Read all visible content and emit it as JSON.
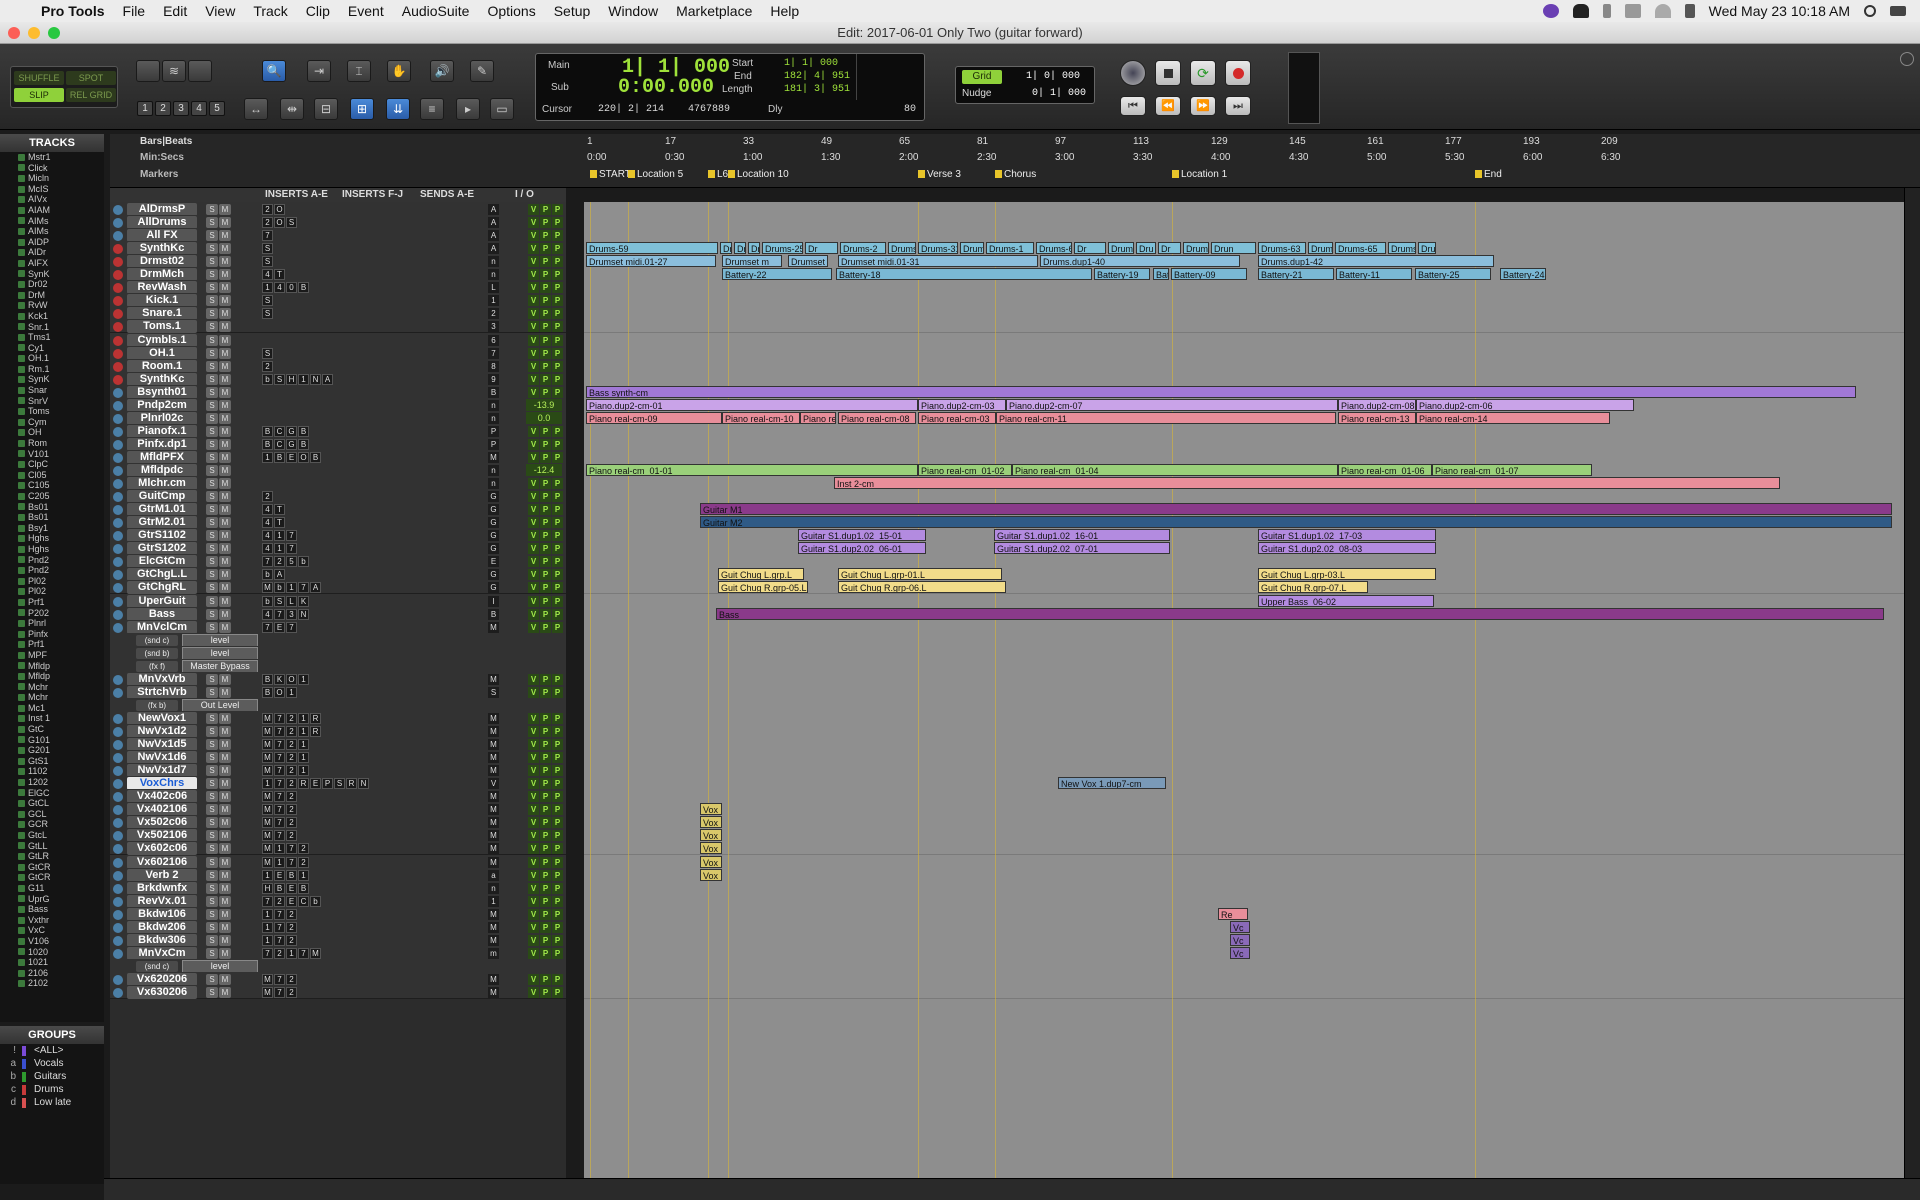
{
  "menubar": {
    "app": "Pro Tools",
    "items": [
      "File",
      "Edit",
      "View",
      "Track",
      "Clip",
      "Event",
      "AudioSuite",
      "Options",
      "Setup",
      "Window",
      "Marketplace",
      "Help"
    ],
    "clock": "Wed May 23  10:18 AM"
  },
  "window": {
    "title": "Edit: 2017-06-01 Only Two (guitar forward)"
  },
  "toolbar": {
    "modes": [
      "SHUFFLE",
      "SPOT",
      "SLIP",
      "REL GRID"
    ],
    "zoom_presets": [
      "1",
      "2",
      "3",
      "4",
      "5"
    ]
  },
  "counter": {
    "main_label": "Main",
    "main": "1| 1| 000",
    "sub_label": "Sub",
    "sub": "0:00.000",
    "start_label": "Start",
    "start": "1| 1| 000",
    "end_label": "End",
    "end": "182| 4| 951",
    "length_label": "Length",
    "length": "181| 3| 951",
    "cursor_label": "Cursor",
    "cursor": "220| 2| 214",
    "samples": "4767889",
    "dly_label": "Dly",
    "num": "80"
  },
  "grid": {
    "grid_label": "Grid",
    "grid": "1| 0| 000",
    "nudge_label": "Nudge",
    "nudge": "0| 1| 000"
  },
  "ruler": {
    "bars_label": "Bars|Beats",
    "minsecs_label": "Min:Secs",
    "markers_label": "Markers",
    "bars": [
      "1",
      "17",
      "33",
      "49",
      "65",
      "81",
      "97",
      "113",
      "129",
      "145",
      "161",
      "177",
      "193",
      "209"
    ],
    "times": [
      "0:00",
      "0:30",
      "1:00",
      "1:30",
      "2:00",
      "2:30",
      "3:00",
      "3:30",
      "4:00",
      "4:30",
      "5:00",
      "5:30",
      "6:00",
      "6:30"
    ],
    "markers": [
      "START",
      "Location 5",
      "L6",
      "Location 10",
      "Verse 3",
      "Chorus",
      "Location 1",
      "End"
    ]
  },
  "columns": {
    "inserts_ae": "INSERTS A-E",
    "inserts_fj": "INSERTS F-J",
    "sends_ae": "SENDS A-E",
    "io": "I / O"
  },
  "sidebar": {
    "tracks_title": "TRACKS",
    "groups_title": "GROUPS",
    "track_list": [
      "Mstr1",
      "Click",
      "Micln",
      "McIS",
      "AIVx",
      "AIAM",
      "AIMs",
      "AIMs",
      "AIDP",
      "AIDr",
      "AIFX",
      "SynK",
      "Dr02",
      "DrM",
      "RvW",
      "Kck1",
      "Snr.1",
      "Tms1",
      "Cy1",
      "OH.1",
      "Rm.1",
      "SynK",
      "Snar",
      "SnrV",
      "Toms",
      "Cym",
      "OH",
      "Rom",
      "V101",
      "ClpC",
      "Cl05",
      "C105",
      "C205",
      "Bs01",
      "Bs01",
      "Bsy1",
      "Hghs",
      "Hghs",
      "Pnd2",
      "Pnd2",
      "Pl02",
      "Pl02",
      "Prf1",
      "P202",
      "Plnrl",
      "Pinfx",
      "Prf1",
      "MPF",
      "Mfldp",
      "Mfldp",
      "Mchr",
      "Mchr",
      "Mc1",
      "Inst 1",
      "GtC",
      "G101",
      "G201",
      "GtS1",
      "1102",
      "1202",
      "ElGC",
      "GtCL",
      "GCL",
      "GCR",
      "GtcL",
      "GtLL",
      "GtLR",
      "GtCR",
      "GtCR",
      "G11",
      "UprG",
      "Bass",
      "Vxthr",
      "VxC",
      "V106",
      "1020",
      "1021",
      "2106",
      "2102"
    ],
    "groups": [
      {
        "id": "!",
        "name": "<ALL>",
        "color": "#7b4bd6"
      },
      {
        "id": "a",
        "name": "Vocals",
        "color": "#3a4fd0"
      },
      {
        "id": "b",
        "name": "Guitars",
        "color": "#2e9a2e"
      },
      {
        "id": "c",
        "name": "Drums",
        "color": "#c73a3a"
      },
      {
        "id": "d",
        "name": "Low late",
        "color": "#d85050"
      }
    ]
  },
  "tracks": [
    {
      "name": "AlDrmsP",
      "ins": [
        "2",
        "O"
      ],
      "io": "A",
      "vol": ""
    },
    {
      "name": "AllDrums",
      "ins": [
        "2",
        "O",
        "S"
      ],
      "io": "A",
      "vol": ""
    },
    {
      "name": "All FX",
      "ins": [
        "7"
      ],
      "io": "A",
      "vol": ""
    },
    {
      "name": "SynthKc",
      "ins": [
        "S"
      ],
      "io": "A",
      "vol": "",
      "rec": "red"
    },
    {
      "name": "Drmst02",
      "ins": [
        "S"
      ],
      "io": "n",
      "vol": "",
      "rec": "red"
    },
    {
      "name": "DrmMch",
      "ins": [
        "4",
        "T"
      ],
      "io": "n",
      "vol": "",
      "rec": "red"
    },
    {
      "name": "RevWash",
      "ins": [
        "1",
        "4",
        "0",
        "B"
      ],
      "io": "L",
      "vol": "",
      "rec": "red"
    },
    {
      "name": "Kick.1",
      "ins": [
        "S"
      ],
      "io": "1",
      "vol": "",
      "rec": "red"
    },
    {
      "name": "Snare.1",
      "ins": [
        "S"
      ],
      "io": "2",
      "vol": "",
      "rec": "red"
    },
    {
      "name": "Toms.1",
      "ins": [],
      "io": "3",
      "vol": "",
      "rec": "red"
    },
    {
      "name": "Cymbls.1",
      "ins": [],
      "io": "6",
      "vol": "",
      "rec": "red"
    },
    {
      "name": "OH.1",
      "ins": [
        "S"
      ],
      "io": "7",
      "vol": "",
      "rec": "red"
    },
    {
      "name": "Room.1",
      "ins": [
        "2"
      ],
      "io": "8",
      "vol": "",
      "rec": "red"
    },
    {
      "name": "SynthKc",
      "ins": [
        "b",
        "S",
        "H",
        "1",
        "N",
        "A"
      ],
      "io": "9",
      "vol": "",
      "rec": "red"
    },
    {
      "name": "Bsynth01",
      "ins": [],
      "io": "B",
      "vol": ""
    },
    {
      "name": "Pndp2cm",
      "ins": [],
      "io": "n",
      "vol": "-13.9"
    },
    {
      "name": "Plnrl02c",
      "ins": [],
      "io": "n",
      "vol": "0.0"
    },
    {
      "name": "Pianofx.1",
      "ins": [
        "B",
        "C",
        "G",
        "B"
      ],
      "io": "P",
      "vol": ""
    },
    {
      "name": "Pinfx.dp1",
      "ins": [
        "B",
        "C",
        "G",
        "B"
      ],
      "io": "P",
      "vol": ""
    },
    {
      "name": "MfldPFX",
      "ins": [
        "1",
        "B",
        "E",
        "O",
        "B"
      ],
      "io": "M",
      "vol": ""
    },
    {
      "name": "Mfldpdc",
      "ins": [],
      "io": "n",
      "vol": "-12.4"
    },
    {
      "name": "Mlchr.cm",
      "ins": [],
      "io": "n",
      "vol": ""
    },
    {
      "name": "GuitCmp",
      "ins": [
        "2"
      ],
      "io": "G",
      "vol": ""
    },
    {
      "name": "GtrM1.01",
      "ins": [
        "4",
        "T"
      ],
      "io": "G",
      "vol": ""
    },
    {
      "name": "GtrM2.01",
      "ins": [
        "4",
        "T"
      ],
      "io": "G",
      "vol": ""
    },
    {
      "name": "GtrS1102",
      "ins": [
        "4",
        "1",
        "7"
      ],
      "io": "G",
      "vol": ""
    },
    {
      "name": "GtrS1202",
      "ins": [
        "4",
        "1",
        "7"
      ],
      "io": "G",
      "vol": ""
    },
    {
      "name": "ElcGtCm",
      "ins": [
        "7",
        "2",
        "5",
        "b"
      ],
      "io": "E",
      "vol": ""
    },
    {
      "name": "GtChgL.L",
      "ins": [
        "b",
        "A"
      ],
      "io": "G",
      "vol": ""
    },
    {
      "name": "GtChgRL",
      "ins": [
        "M",
        "b",
        "1",
        "7",
        "A"
      ],
      "io": "G",
      "vol": ""
    },
    {
      "name": "UperGuit",
      "ins": [
        "b",
        "S",
        "L",
        "K"
      ],
      "io": "I",
      "vol": ""
    },
    {
      "name": "Bass",
      "ins": [
        "4",
        "7",
        "3",
        "N"
      ],
      "io": "B",
      "vol": ""
    },
    {
      "name": "MnVclCm",
      "ins": [
        "7",
        "E",
        "7"
      ],
      "io": "M",
      "vol": ""
    },
    {
      "sub": "(snd c)",
      "level": "level"
    },
    {
      "sub": "(snd b)",
      "level": "level"
    },
    {
      "sub": "(fx f)",
      "level": "Master Bypass"
    },
    {
      "name": "MnVxVrb",
      "ins": [
        "B",
        "K",
        "O",
        "1"
      ],
      "io": "M",
      "vol": ""
    },
    {
      "name": "StrtchVrb",
      "ins": [
        "B",
        "O",
        "1"
      ],
      "io": "S",
      "vol": ""
    },
    {
      "sub": "(fx b)",
      "level": "Out Level"
    },
    {
      "name": "NewVox1",
      "ins": [
        "M",
        "7",
        "2",
        "1",
        "R"
      ],
      "io": "M",
      "vol": ""
    },
    {
      "name": "NwVx1d2",
      "ins": [
        "M",
        "7",
        "2",
        "1",
        "R"
      ],
      "io": "M",
      "vol": ""
    },
    {
      "name": "NwVx1d5",
      "ins": [
        "M",
        "7",
        "2",
        "1"
      ],
      "io": "M",
      "vol": ""
    },
    {
      "name": "NwVx1d6",
      "ins": [
        "M",
        "7",
        "2",
        "1"
      ],
      "io": "M",
      "vol": ""
    },
    {
      "name": "NwVx1d7",
      "ins": [
        "M",
        "7",
        "2",
        "1"
      ],
      "io": "M",
      "vol": ""
    },
    {
      "name": "VoxChrs",
      "ins": [
        "1",
        "7",
        "2",
        "R",
        "E",
        "P",
        "S",
        "R",
        "N"
      ],
      "io": "V",
      "vol": "",
      "sel": true
    },
    {
      "name": "Vx402c06",
      "ins": [
        "M",
        "7",
        "2"
      ],
      "io": "M",
      "vol": ""
    },
    {
      "name": "Vx402106",
      "ins": [
        "M",
        "7",
        "2"
      ],
      "io": "M",
      "vol": ""
    },
    {
      "name": "Vx502c06",
      "ins": [
        "M",
        "7",
        "2"
      ],
      "io": "M",
      "vol": ""
    },
    {
      "name": "Vx502106",
      "ins": [
        "M",
        "7",
        "2"
      ],
      "io": "M",
      "vol": ""
    },
    {
      "name": "Vx602c06",
      "ins": [
        "M",
        "1",
        "7",
        "2"
      ],
      "io": "M",
      "vol": ""
    },
    {
      "name": "Vx602106",
      "ins": [
        "M",
        "1",
        "7",
        "2"
      ],
      "io": "M",
      "vol": ""
    },
    {
      "name": "Verb 2",
      "ins": [
        "1",
        "E",
        "B",
        "1"
      ],
      "io": "a",
      "vol": ""
    },
    {
      "name": "Brkdwnfx",
      "ins": [
        "H",
        "B",
        "E",
        "B"
      ],
      "io": "n",
      "vol": ""
    },
    {
      "name": "RevVx.01",
      "ins": [
        "7",
        "2",
        "E",
        "C",
        "b"
      ],
      "io": "1",
      "vol": ""
    },
    {
      "name": "Bkdw106",
      "ins": [
        "1",
        "7",
        "2"
      ],
      "io": "M",
      "vol": ""
    },
    {
      "name": "Bkdw206",
      "ins": [
        "1",
        "7",
        "2"
      ],
      "io": "M",
      "vol": ""
    },
    {
      "name": "Bkdw306",
      "ins": [
        "1",
        "7",
        "2"
      ],
      "io": "M",
      "vol": ""
    },
    {
      "name": "MnVxCm",
      "ins": [
        "7",
        "2",
        "1",
        "7",
        "M"
      ],
      "io": "m",
      "vol": ""
    },
    {
      "sub": "(snd c)",
      "level": "level"
    },
    {
      "name": "Vx620206",
      "ins": [
        "M",
        "7",
        "2"
      ],
      "io": "M",
      "vol": ""
    },
    {
      "name": "Vx630206",
      "ins": [
        "M",
        "7",
        "2"
      ],
      "io": "M",
      "vol": ""
    }
  ],
  "clips": {
    "drums": [
      "Drums-59",
      "Dr",
      "Dr",
      "Dr",
      "Drums-25",
      "Dr",
      "Drums-2",
      "Drums",
      "Drums-31",
      "Drum",
      "Drums-1",
      "Drums-6",
      "Dr",
      "Drums-34",
      "Dru",
      "Dr",
      "Drums",
      "Drun",
      "Drums-63",
      "Drums",
      "Drums-65",
      "Drums",
      "Dru"
    ],
    "drum_midi": [
      "Drumset midi.01-27",
      "Drumset m",
      "Drumset midi",
      "Drumset midi.01-31",
      "Drums.dup1-40",
      "Drums.dup1-42"
    ],
    "battery": [
      "Battery-22",
      "Battery-18",
      "Battery-19",
      "Bat",
      "Battery-09",
      "Battery-21",
      "Battery-11",
      "Battery-25",
      "Battery-24"
    ],
    "bass_synth": "Bass synth-cm",
    "piano_dup": [
      "Piano.dup2-cm-01",
      "Piano.dup2-cm-03",
      "Piano.dup2-cm-07",
      "Piano.dup2-cm-08",
      "Piano.dup2-cm-06"
    ],
    "piano_real": [
      "Piano real-cm-09",
      "Piano real-cm-10",
      "Piano re",
      "Piano real-cm-08",
      "Piano real-cm-03",
      "Piano real-cm-11",
      "Piano real-cm-13",
      "Piano real-cm-14"
    ],
    "mfld": [
      "Piano real-cm_01-01",
      "Piano real-cm_01-02",
      "Piano real-cm_01-04",
      "Piano real-cm_01-06",
      "Piano real-cm_01-07"
    ],
    "inst": "Inst 2-cm",
    "guitar_m1": "Guitar M1",
    "guitar_m2": "Guitar M2",
    "guitar_s1": [
      "Guitar S1.dup1.02_15-01",
      "Guitar S1.dup1.02_16-01",
      "Guitar S1.dup1.02_17-03"
    ],
    "guitar_s2": [
      "Guitar S1.dup2.02_06-01",
      "Guitar S1.dup2.02_07-01",
      "Guitar S1.dup2.02_08-03"
    ],
    "chug_l": [
      "Guit Chug L.grp.L",
      "Guit Chug L.grp-01.L",
      "Guit Chug L.grp-03.L"
    ],
    "chug_r": [
      "Guit Chug R.grp-05.L",
      "Guit Chug R.grp-06.L",
      "Guit Chug R.grp-07.L"
    ],
    "upper_bass": "Upper Bass_06-02",
    "bass": "Bass",
    "newvox": "New Vox 1.dup7-cm",
    "vox": "Vox",
    "rev": "Re",
    "vc": "Vc"
  }
}
